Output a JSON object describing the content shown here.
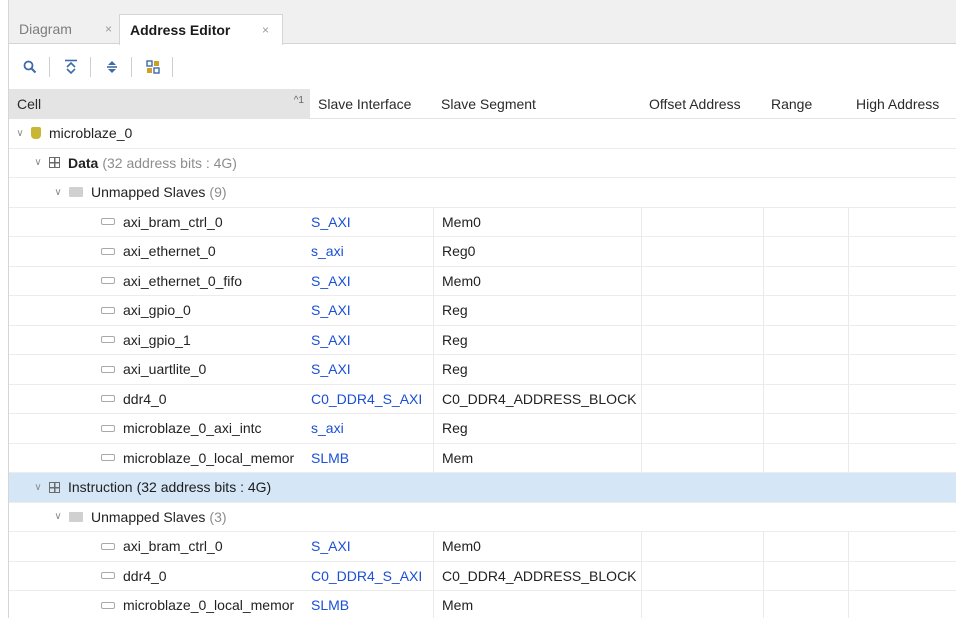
{
  "tabs": [
    {
      "label": "Diagram",
      "close": "×"
    },
    {
      "label": "Address Editor",
      "close": "×"
    }
  ],
  "toolbar": {
    "icons": [
      "search-icon",
      "collapse-all-icon",
      "expand-all-icon",
      "auto-assign-icon"
    ]
  },
  "columns": {
    "cell": "Cell",
    "cell_sort": "^1",
    "slave_interface": "Slave Interface",
    "slave_segment": "Slave Segment",
    "offset_address": "Offset Address",
    "range": "Range",
    "high_address": "High Address"
  },
  "rows": [
    {
      "type": "master",
      "name": "microblaze_0"
    },
    {
      "type": "space",
      "name": "Data",
      "suffix": "(32 address bits : 4G)"
    },
    {
      "type": "group",
      "name": "Unmapped Slaves",
      "suffix": "(9)"
    },
    {
      "type": "slave",
      "name": "axi_bram_ctrl_0",
      "interface": "S_AXI",
      "segment": "Mem0"
    },
    {
      "type": "slave",
      "name": "axi_ethernet_0",
      "interface": "s_axi",
      "segment": "Reg0"
    },
    {
      "type": "slave",
      "name": "axi_ethernet_0_fifo",
      "interface": "S_AXI",
      "segment": "Mem0"
    },
    {
      "type": "slave",
      "name": "axi_gpio_0",
      "interface": "S_AXI",
      "segment": "Reg"
    },
    {
      "type": "slave",
      "name": "axi_gpio_1",
      "interface": "S_AXI",
      "segment": "Reg"
    },
    {
      "type": "slave",
      "name": "axi_uartlite_0",
      "interface": "S_AXI",
      "segment": "Reg"
    },
    {
      "type": "slave",
      "name": "ddr4_0",
      "interface": "C0_DDR4_S_AXI",
      "segment": "C0_DDR4_ADDRESS_BLOCK"
    },
    {
      "type": "slave",
      "name": "microblaze_0_axi_intc",
      "interface": "s_axi",
      "segment": "Reg"
    },
    {
      "type": "slave",
      "name": "microblaze_0_local_memor",
      "interface": "SLMB",
      "segment": "Mem"
    },
    {
      "type": "space",
      "name": "Instruction",
      "suffix": "(32 address bits : 4G)",
      "selected": true
    },
    {
      "type": "group",
      "name": "Unmapped Slaves",
      "suffix": "(3)"
    },
    {
      "type": "slave",
      "name": "axi_bram_ctrl_0",
      "interface": "S_AXI",
      "segment": "Mem0"
    },
    {
      "type": "slave",
      "name": "ddr4_0",
      "interface": "C0_DDR4_S_AXI",
      "segment": "C0_DDR4_ADDRESS_BLOCK"
    },
    {
      "type": "slave",
      "name": "microblaze_0_local_memor",
      "interface": "SLMB",
      "segment": "Mem"
    }
  ],
  "colors": {
    "link": "#1a4fd6",
    "selected_row": "#d5e6f7",
    "header_sorted": "#e4e4e4"
  }
}
